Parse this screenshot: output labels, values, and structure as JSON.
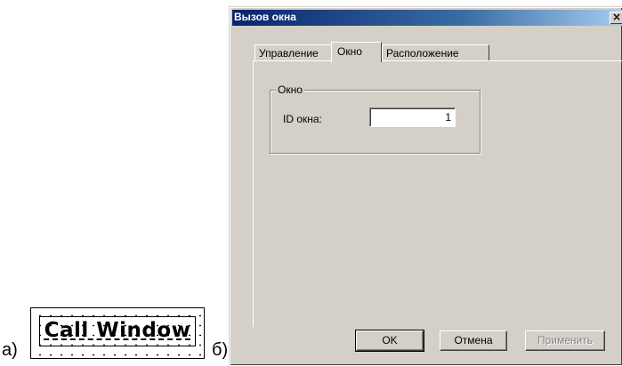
{
  "captions": {
    "a": "а)",
    "b": "б)"
  },
  "preview": {
    "button_label": "Call Window"
  },
  "dialog": {
    "title": "Вызов окна",
    "close_glyph": "×",
    "tabs": [
      {
        "label": "Управление",
        "active": false
      },
      {
        "label": "Окно",
        "active": true
      },
      {
        "label": "Расположение",
        "active": false
      }
    ],
    "group": {
      "legend": "Окно",
      "field_label": "ID окна:",
      "field_value": "1"
    },
    "buttons": {
      "ok": "OK",
      "cancel": "Отмена",
      "apply": "Применить"
    },
    "colors": {
      "face": "#d4d0c8",
      "title_start": "#0a246a",
      "title_end": "#a6caf0"
    }
  }
}
